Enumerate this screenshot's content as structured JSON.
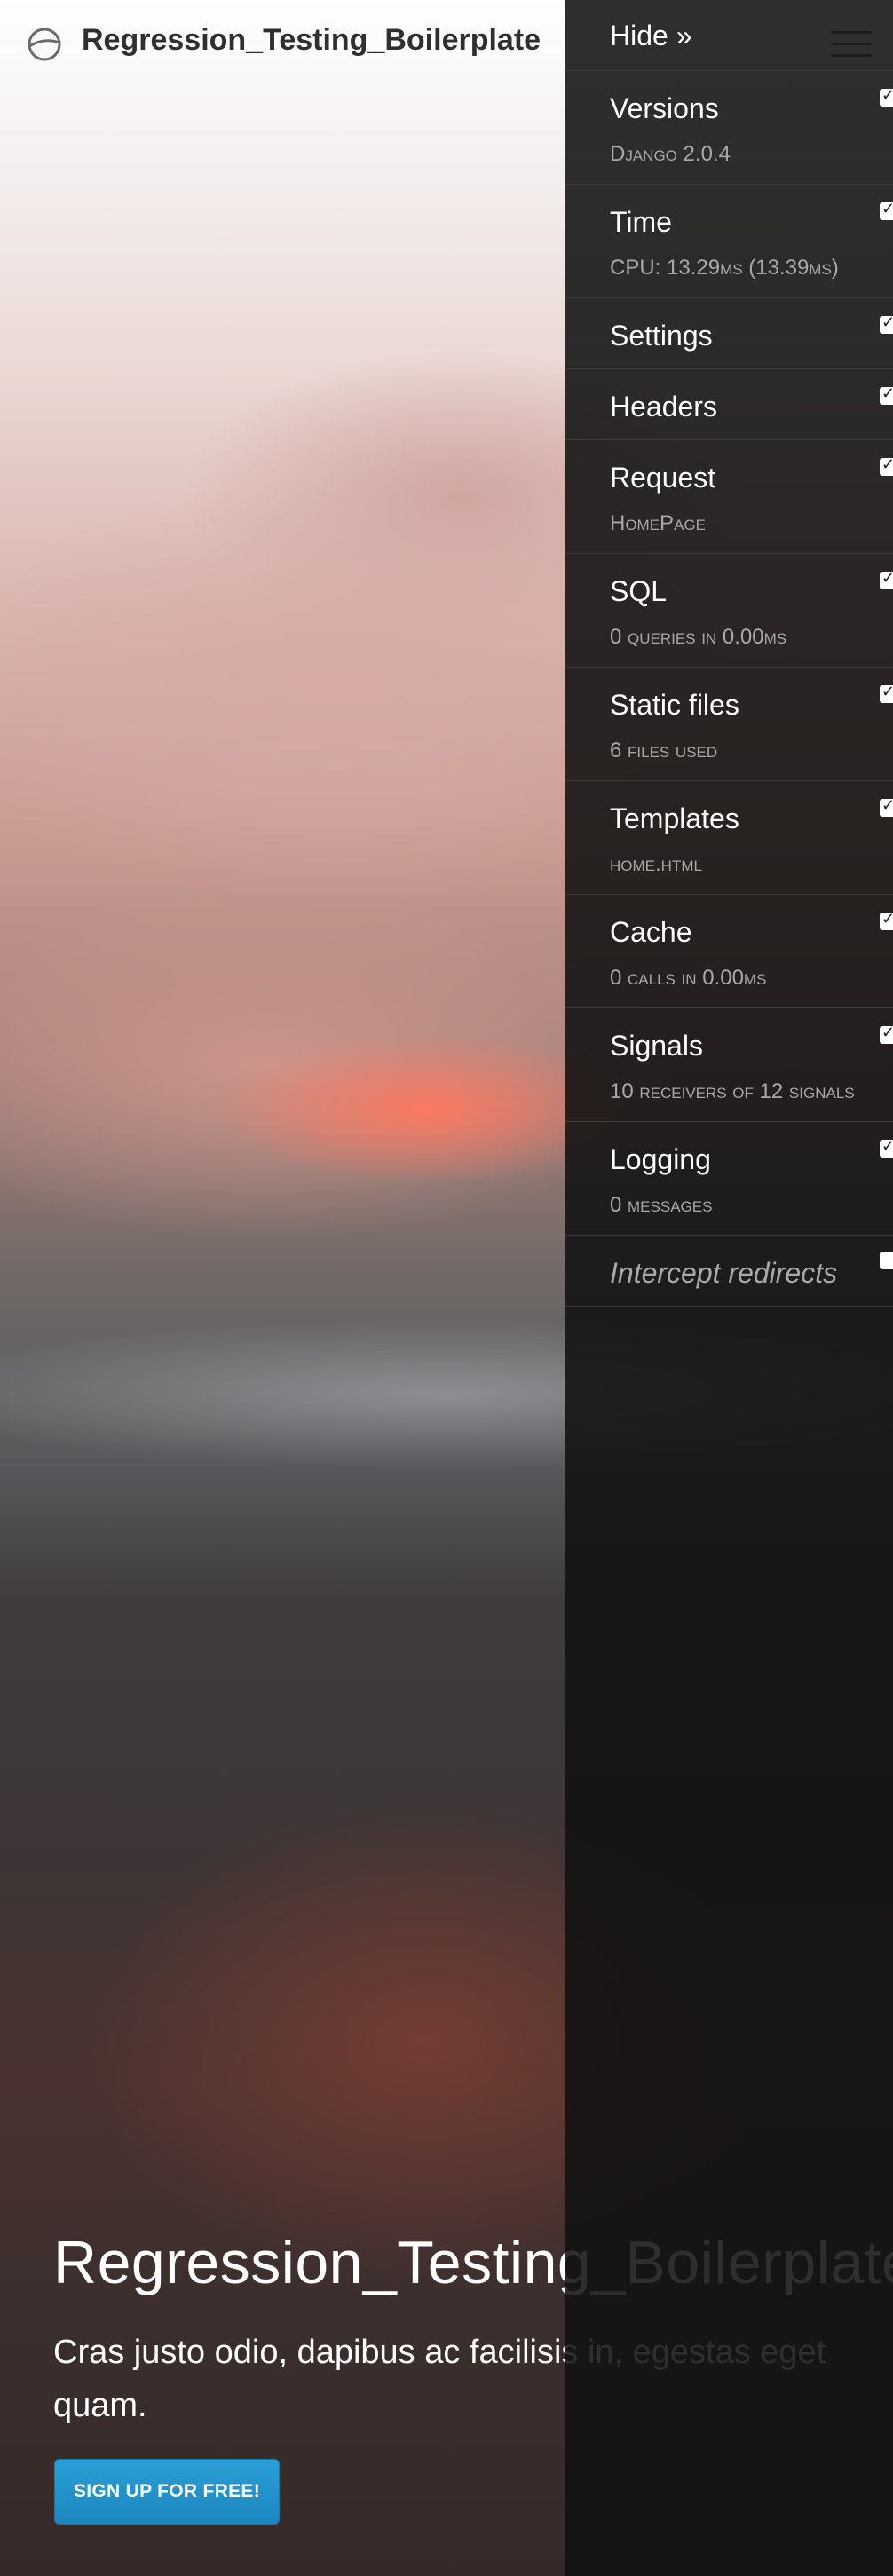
{
  "header": {
    "brand": "Regression_Testing_Boilerplate"
  },
  "hero": {
    "title": "Regression_Testing_Boilerplate",
    "subtitle": "Cras justo odio, dapibus ac facilisis in, egestas eget quam.",
    "signup_label": "SIGN UP FOR FREE!"
  },
  "toolbar": {
    "hide_label": "Hide »",
    "panels": [
      {
        "title": "Versions",
        "subtitle": "Django 2.0.4",
        "checked": true
      },
      {
        "title": "Time",
        "subtitle": "CPU: 13.29ms (13.39ms)",
        "checked": true
      },
      {
        "title": "Settings",
        "subtitle": "",
        "checked": true
      },
      {
        "title": "Headers",
        "subtitle": "",
        "checked": true
      },
      {
        "title": "Request",
        "subtitle": "HomePage",
        "checked": true
      },
      {
        "title": "SQL",
        "subtitle": "0 queries in 0.00ms",
        "checked": true
      },
      {
        "title": "Static files",
        "subtitle": "6 files used",
        "checked": true
      },
      {
        "title": "Templates",
        "subtitle": "home.html",
        "checked": true
      },
      {
        "title": "Cache",
        "subtitle": "0 calls in 0.00ms",
        "checked": true
      },
      {
        "title": "Signals",
        "subtitle": "10 receivers of 12 signals",
        "checked": true
      },
      {
        "title": "Logging",
        "subtitle": "0 messages",
        "checked": true
      },
      {
        "title": "Intercept redirects",
        "subtitle": "",
        "checked": false
      }
    ]
  },
  "colors": {
    "accent": "#2a9fd6",
    "toolbar_bg": "#111111"
  }
}
